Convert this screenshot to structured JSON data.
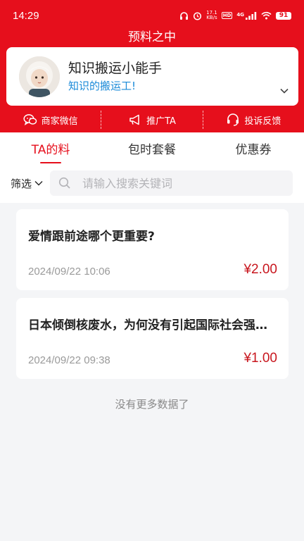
{
  "status_bar": {
    "time": "14:29",
    "network_speed": "17.1\nKB/s",
    "hd_label": "HD",
    "signal_label": "4G",
    "battery": "91"
  },
  "app_title": "预料之中",
  "profile": {
    "name": "知识搬运小能手",
    "description": "知识的搬运工!"
  },
  "actions": [
    {
      "label": "商家微信",
      "icon": "wechat-icon"
    },
    {
      "label": "推广TA",
      "icon": "megaphone-icon"
    },
    {
      "label": "投诉反馈",
      "icon": "headset-icon"
    }
  ],
  "tabs": [
    {
      "label": "TA的料",
      "active": true
    },
    {
      "label": "包时套餐",
      "active": false
    },
    {
      "label": "优惠券",
      "active": false
    }
  ],
  "filter": {
    "label": "筛选",
    "search_placeholder": "请输入搜索关键词"
  },
  "items": [
    {
      "title": "爱情跟前途哪个更重要?",
      "date": "2024/09/22 10:06",
      "price": "¥2.00"
    },
    {
      "title": "日本倾倒核废水，为何没有引起国际社会强烈反对",
      "date": "2024/09/22 09:38",
      "price": "¥1.00"
    }
  ],
  "footer_text": "没有更多数据了",
  "colors": {
    "brand_red": "#e60f1c",
    "link_blue": "#1a8ad8",
    "price_red": "#c8161e"
  }
}
